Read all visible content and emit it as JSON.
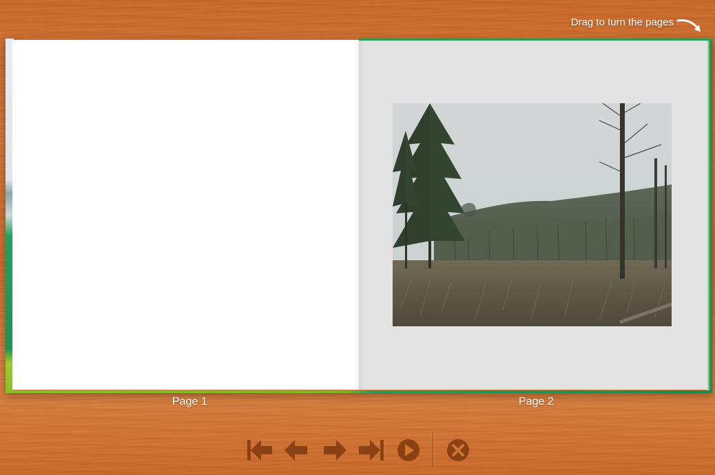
{
  "hint": {
    "text": "Drag to turn the pages",
    "icon": "curved-arrow-icon"
  },
  "pages": [
    {
      "label": "Page 1"
    },
    {
      "label": "Page 2"
    }
  ],
  "photo": {
    "description_icon": "forest-landscape-photo"
  },
  "controls": {
    "first": {
      "icon": "skip-to-first-icon"
    },
    "previous": {
      "icon": "arrow-left-icon"
    },
    "next": {
      "icon": "arrow-right-icon"
    },
    "last": {
      "icon": "skip-to-last-icon"
    },
    "play": {
      "icon": "play-icon"
    },
    "close": {
      "icon": "close-icon"
    }
  },
  "colors": {
    "wood": "#cf7433",
    "icon_brown": "#8a4214",
    "cover_green": "#1e9552",
    "page_right_bg": "#e3e3e3"
  }
}
